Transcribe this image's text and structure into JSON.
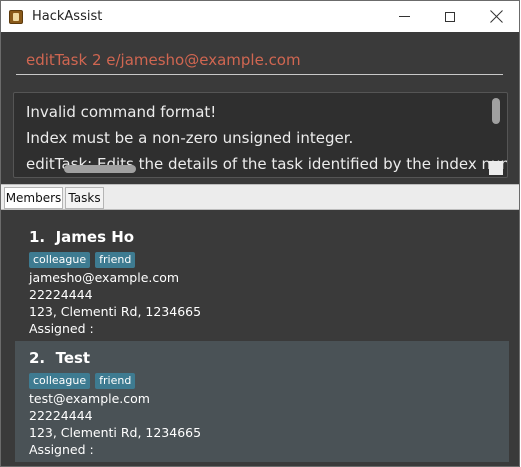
{
  "window": {
    "title": "HackAssist"
  },
  "command": {
    "value": "editTask 2 e/jamesho@example.com"
  },
  "result": {
    "lines": [
      "Invalid command format!",
      "Index must be a non-zero unsigned integer.",
      "editTask: Edits the details of the task identified by the index number"
    ]
  },
  "tabs": [
    {
      "label": "Members"
    },
    {
      "label": "Tasks"
    }
  ],
  "members": [
    {
      "index": "1.",
      "name": "James Ho",
      "tags": [
        "colleague",
        "friend"
      ],
      "email": "jamesho@example.com",
      "phone": "22224444",
      "address": "123, Clementi Rd, 1234665",
      "assigned": "Assigned :"
    },
    {
      "index": "2.",
      "name": "Test",
      "tags": [
        "colleague",
        "friend"
      ],
      "email": "test@example.com",
      "phone": "22224444",
      "address": "123, Clementi Rd, 1234665",
      "assigned": "Assigned :"
    }
  ],
  "colors": {
    "command_text": "#d06651",
    "tag_bg": "#3e7b91",
    "selected_card": "#4a5256",
    "panel_bg": "#3a3a3a"
  },
  "icons": {
    "app": "app-icon",
    "minimize": "minimize-icon",
    "maximize": "maximize-icon",
    "close": "close-icon"
  }
}
